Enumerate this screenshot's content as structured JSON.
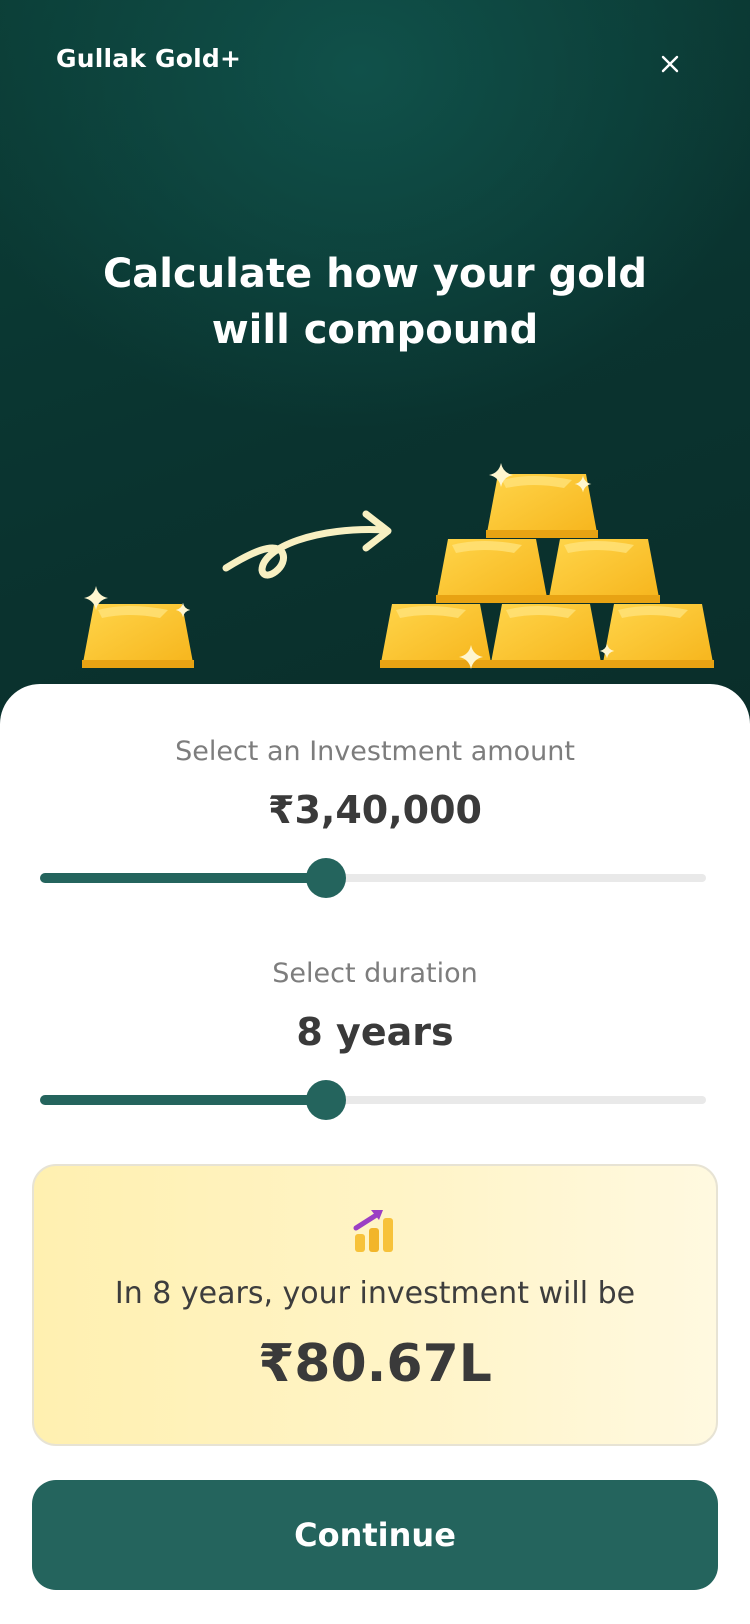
{
  "header": {
    "brand": "Gullak Gold+",
    "close_icon": "close-icon"
  },
  "hero": {
    "headline_line1": "Calculate how your gold",
    "headline_line2": "will compound",
    "illustration_icons": [
      "gold-bar-icon",
      "curved-arrow-icon",
      "gold-bar-pyramid-icon",
      "sparkle-icon"
    ]
  },
  "investment": {
    "label": "Select an Investment amount",
    "value": "₹3,40,000",
    "slider_level": 0.43
  },
  "duration": {
    "label": "Select duration",
    "value": "8 years",
    "slider_level": 0.43
  },
  "result": {
    "icon": "growth-chart-icon",
    "text": "In 8 years, your investment will be",
    "value": "₹80.67L"
  },
  "actions": {
    "continue_label": "Continue"
  },
  "colors": {
    "hero_bg": "#0b3d36",
    "accent": "#24645d",
    "gold": "#fbbf24",
    "card_bg": "#fff4c7",
    "track": "#e9e9e9"
  }
}
